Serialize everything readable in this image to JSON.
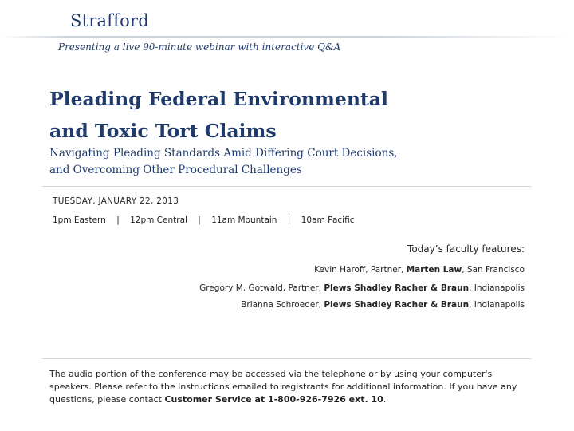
{
  "brand": {
    "logo": "Strafford",
    "tagline": "Presenting a live 90-minute webinar with interactive Q&A"
  },
  "title": {
    "line1": "Pleading Federal Environmental",
    "line2": "and Toxic Tort Claims"
  },
  "subtitle": {
    "line1": "Navigating Pleading Standards Amid Differing Court Decisions,",
    "line2": "and Overcoming Other Procedural Challenges"
  },
  "schedule": {
    "date": "TUESDAY, JANUARY 22, 2013",
    "times": [
      "1pm Eastern",
      "12pm Central",
      "11am Mountain",
      "10am Pacific"
    ],
    "separator": "|"
  },
  "faculty": {
    "heading": "Today’s faculty features:",
    "members": [
      {
        "name": "Kevin Haroff, Partner,",
        "firm": "Marten Law",
        "city": ", San Francisco"
      },
      {
        "name": "Gregory M. Gotwald, Partner,",
        "firm": "Plews Shadley Racher & Braun",
        "city": ", Indianapolis"
      },
      {
        "name": "Brianna Schroeder,",
        "firm": "Plews Shadley Racher & Braun",
        "city": ", Indianapolis"
      }
    ]
  },
  "audio": {
    "text": "The audio portion of the conference may be accessed via the telephone or by using your computer's speakers. Please refer to the instructions emailed to registrants for additional information.  If you have any questions, please contact ",
    "contact": "Customer Service at 1-800-926-7926 ext. 10",
    "end": "."
  },
  "colors": {
    "title": "#1f3a6b",
    "text": "#222222",
    "rule": "#d4d4d4"
  }
}
